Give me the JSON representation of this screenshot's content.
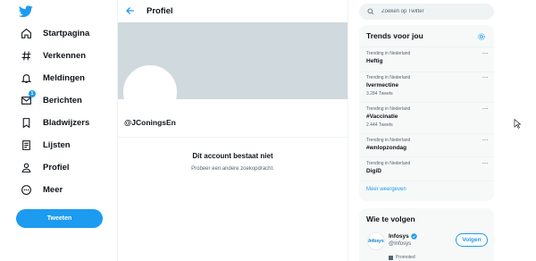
{
  "brand_color": "#1d9bf0",
  "sidebar": {
    "items": [
      {
        "label": "Startpagina",
        "icon": "home-icon"
      },
      {
        "label": "Verkennen",
        "icon": "hashtag-icon"
      },
      {
        "label": "Meldingen",
        "icon": "bell-icon"
      },
      {
        "label": "Berichten",
        "icon": "envelope-icon",
        "badge": "1"
      },
      {
        "label": "Bladwijzers",
        "icon": "bookmark-icon"
      },
      {
        "label": "Lijsten",
        "icon": "list-icon"
      },
      {
        "label": "Profiel",
        "icon": "person-icon"
      },
      {
        "label": "Meer",
        "icon": "more-circle-icon"
      }
    ],
    "tweet_label": "Tweeten"
  },
  "main": {
    "title": "Profiel",
    "handle": "@JConingsEn",
    "not_found_title": "Dit account bestaat niet",
    "not_found_sub": "Probeer een andere zoekopdracht."
  },
  "search": {
    "placeholder": "Zoeken op Twitter"
  },
  "trends": {
    "title": "Trends voor jou",
    "items": [
      {
        "context": "Trending in Nederland",
        "name": "Heftig",
        "count": ""
      },
      {
        "context": "Trending in Nederland",
        "name": "Ivermectine",
        "count": "3.284 Tweets"
      },
      {
        "context": "Trending in Nederland",
        "name": "#Vaccinatie",
        "count": "2.444 Tweets"
      },
      {
        "context": "Trending in Nederland",
        "name": "#wnlopzondag",
        "count": ""
      },
      {
        "context": "Trending in Nederland",
        "name": "DigiD",
        "count": ""
      }
    ],
    "more_label": "···",
    "show_more": "Meer weergeven"
  },
  "who_to_follow": {
    "title": "Wie te volgen",
    "account": {
      "name": "Infosys",
      "handle": "@Infosys",
      "logo_text": "Infosys",
      "promoted": "Promoted"
    },
    "follow_label": "Volgen"
  }
}
